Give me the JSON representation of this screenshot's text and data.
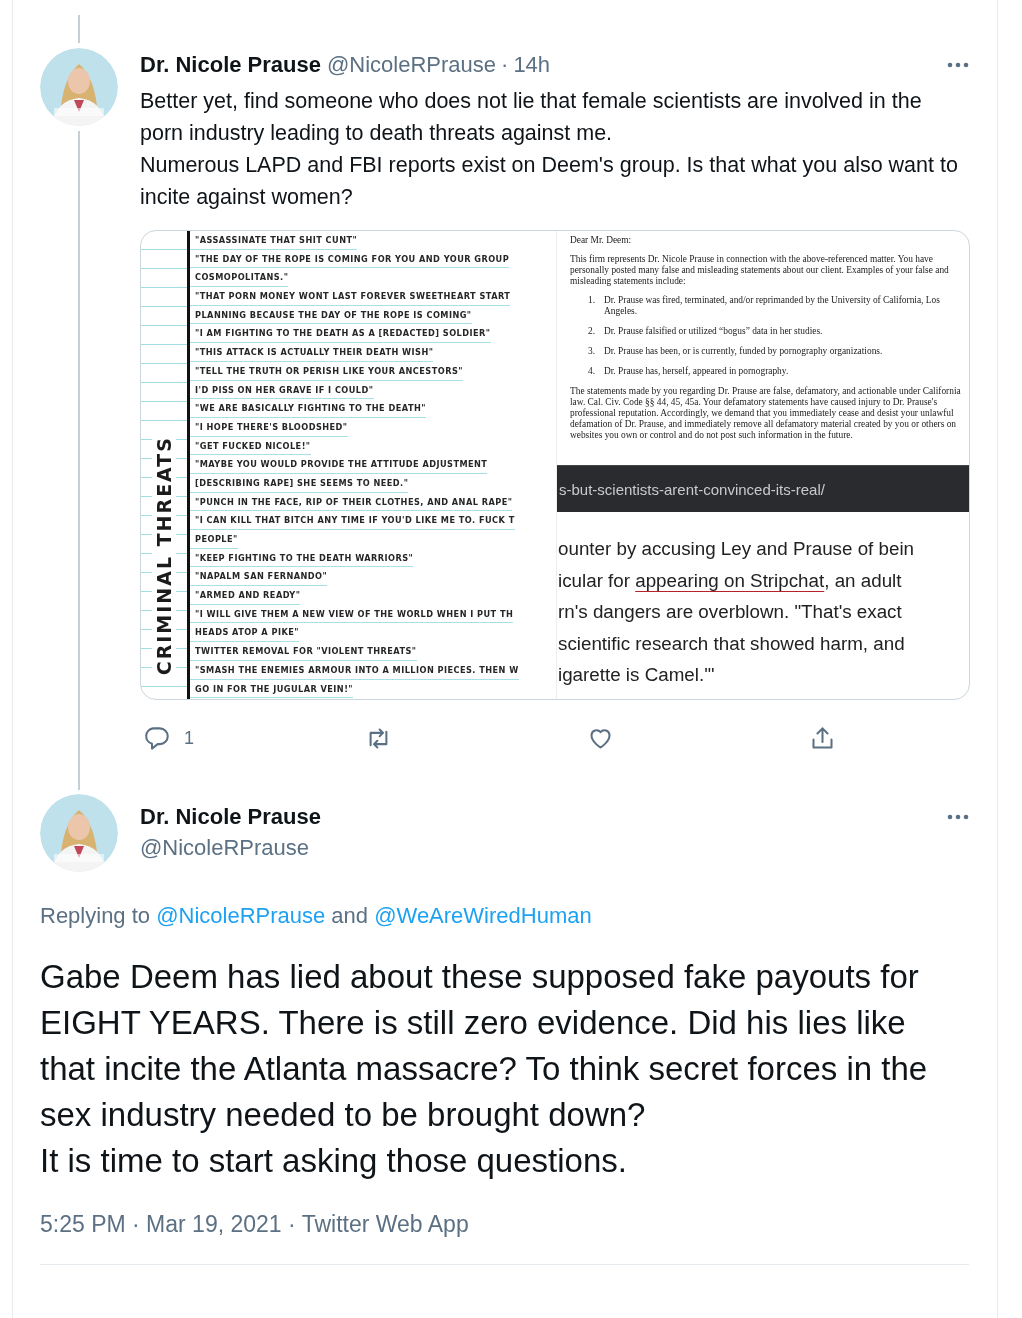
{
  "tweets": [
    {
      "kind": "thread",
      "author": "Dr. Nicole Prause",
      "handle": "@NicoleRPrause",
      "separator": "·",
      "time": "14h",
      "paragraphs": [
        "Better yet, find someone who does not lie that female scientists are involved in the porn industry leading to death threats against me.",
        "Numerous LAPD and FBI reports exist on Deem's group. Is that what you also want to incite against women?"
      ],
      "media": {
        "list_title": "CRIMINAL THREATS",
        "list_rows": [
          "\"ASSASSINATE THAT SHIT CUNT\"",
          "\"THE DAY OF THE ROPE IS COMING FOR YOU AND YOUR GROUP",
          "COSMOPOLITANS.\"",
          "\"THAT PORN MONEY WONT LAST FOREVER SWEETHEART START",
          "PLANNING BECAUSE THE DAY OF THE ROPE IS COMING\"",
          "\"I AM FIGHTING TO THE DEATH AS A [REDACTED] SOLDIER\"",
          "\"THIS ATTACK IS ACTUALLY THEIR DEATH WISH\"",
          "\"TELL THE TRUTH OR PERISH LIKE YOUR ANCESTORS\"",
          "I'D PISS ON HER GRAVE IF I COULD\"",
          "\"WE ARE BASICALLY FIGHTING TO THE DEATH\"",
          "\"I HOPE THERE'S BLOODSHED\"",
          "\"GET FUCKED NICOLE!\"",
          "\"MAYBE YOU WOULD PROVIDE THE ATTITUDE ADJUSTMENT",
          "[DESCRIBING RAPE] SHE SEEMS TO NEED.\"",
          "\"PUNCH IN THE FACE, RIP OF THEIR CLOTHES, AND ANAL RAPE\"",
          "\"I CAN KILL THAT BITCH ANY TIME IF YOU'D LIKE ME TO. FUCK T",
          "PEOPLE\"",
          "\"KEEP FIGHTING TO THE DEATH WARRIORS\"",
          "\"NAPALM SAN FERNANDO\"",
          "\"ARMED AND READY\"",
          "\"I WILL GIVE THEM A NEW VIEW OF THE WORLD WHEN I PUT TH",
          "HEADS ATOP A PIKE\"",
          "TWITTER REMOVAL FOR \"VIOLENT THREATS\"",
          "\"SMASH THE ENEMIES ARMOUR INTO A MILLION PIECES. THEN W",
          "GO IN FOR THE JUGULAR VEIN!\""
        ],
        "letter": {
          "salutation": "Dear Mr. Deem:",
          "intro": "This firm represents Dr. Nicole Prause in connection with the above-referenced matter.  You have personally posted many false and misleading statements about our client.  Examples of your false and misleading statements include:",
          "items": [
            {
              "number": "1.",
              "text": "Dr. Prause was fired, terminated, and/or reprimanded by the University of California, Los Angeles."
            },
            {
              "number": "2.",
              "text": "Dr. Prause falsified or utilized “bogus” data in her studies."
            },
            {
              "number": "3.",
              "text": "Dr. Prause has been, or is currently, funded by pornography organizations."
            },
            {
              "number": "4.",
              "text": "Dr. Prause has, herself, appeared in pornography."
            }
          ],
          "closing": "The statements made by you regarding Dr. Prause are false, defamatory, and actionable under California law.  Cal. Civ. Code §§ 44, 45, 45a.  Your defamatory statements have caused injury to Dr. Prause's professional reputation.  Accordingly, we demand that you immediately cease and desist your unlawful defamation of Dr. Prause, and immediately remove all defamatory material created by you or others on websites you own or control and do not post such information in the future."
        },
        "url": "s-but-scientists-arent-convinced-its-real/",
        "article_lines": [
          [
            {
              "text": "ounter by accusing Ley and Prause of bein",
              "link": false
            }
          ],
          [
            {
              "text": "icular for ",
              "link": false
            },
            {
              "text": "appearing on Stripchat",
              "link": true
            },
            {
              "text": ", an adult",
              "link": false
            }
          ],
          [
            {
              "text": "rn's dangers are overblown. \"That's exact",
              "link": false
            }
          ],
          [
            {
              "text": "scientific research that showed harm, and",
              "link": false
            }
          ],
          [
            {
              "text": "igarette is Camel.'\"",
              "link": false
            }
          ]
        ]
      },
      "actions": [
        {
          "kind": "reply",
          "count": "1"
        },
        {
          "kind": "retweet"
        },
        {
          "kind": "like"
        },
        {
          "kind": "share"
        }
      ]
    },
    {
      "kind": "focal",
      "author": "Dr. Nicole Prause",
      "handle": "@NicoleRPrause",
      "replying": {
        "prefix": "Replying to",
        "mentions": [
          "@NicoleRPrause",
          "@WeAreWiredHuman"
        ],
        "joiner": "and"
      },
      "paragraphs": [
        "Gabe Deem has lied about these supposed fake payouts for EIGHT YEARS. There is still zero evidence. Did his lies like that incite the Atlanta massacre? To think secret forces in the sex industry needed to be brought down?",
        "It is time to start asking those questions."
      ],
      "footer": "5:25 PM · Mar 19, 2021 · Twitter Web App"
    }
  ]
}
